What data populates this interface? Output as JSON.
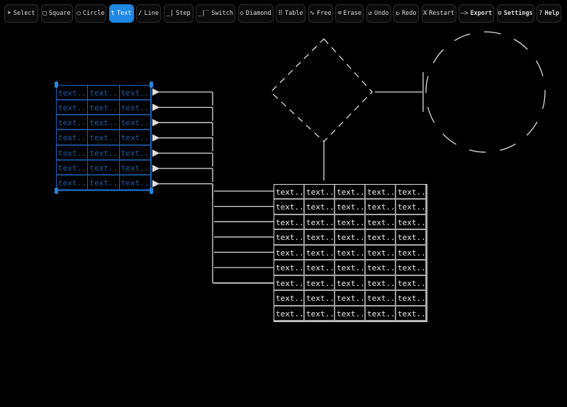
{
  "toolbar": [
    {
      "icon": "➤",
      "label": "Select",
      "name": "select"
    },
    {
      "icon": "□",
      "label": "Square",
      "name": "square"
    },
    {
      "icon": "○",
      "label": "Circle",
      "name": "circle"
    },
    {
      "icon": "t",
      "label": "Text",
      "name": "text",
      "active": true
    },
    {
      "icon": "/",
      "label": "Line",
      "name": "line"
    },
    {
      "icon": "_|",
      "label": "Step",
      "name": "step"
    },
    {
      "icon": "_|‾",
      "label": "Switch",
      "name": "switch"
    },
    {
      "icon": "◇",
      "label": "Diamond",
      "name": "diamond"
    },
    {
      "icon": "⠿",
      "label": "Table",
      "name": "table"
    },
    {
      "icon": "∿",
      "label": "Free",
      "name": "free"
    },
    {
      "icon": "⌫",
      "label": "Erase",
      "name": "erase"
    },
    {
      "icon": "↺",
      "label": "Undo",
      "name": "undo"
    },
    {
      "icon": "↻",
      "label": "Redo",
      "name": "redo"
    },
    {
      "icon": "X",
      "label": "Restart",
      "name": "restart"
    },
    {
      "icon": "—>",
      "label": "Export",
      "name": "export"
    },
    {
      "icon": "⚙",
      "label": "Settings",
      "name": "settings"
    },
    {
      "icon": "?",
      "label": "Help",
      "name": "help"
    }
  ],
  "colors": {
    "accent": "#1e88e5",
    "selected_table": "#1a5fa8",
    "stroke": "#dddddd"
  },
  "left_table": {
    "rows": 7,
    "cols": 3,
    "cell_text": "text...",
    "selected": true
  },
  "right_table": {
    "rows": 9,
    "cols": 5,
    "cell_text": "text..."
  }
}
